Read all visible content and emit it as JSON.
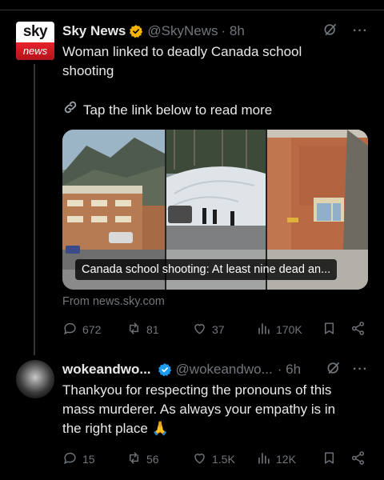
{
  "tweet1": {
    "avatar": {
      "top_text": "sky",
      "bottom_text": "news"
    },
    "name": "Sky News",
    "handle": "@SkyNews",
    "time": "· 8h",
    "text_line1": "Woman linked to deadly Canada school",
    "text_line2": "shooting",
    "link_text": "Tap the link below to read more",
    "card_caption": "Canada school shooting: At least nine dead an...",
    "card_source": "From news.sky.com",
    "replies": "672",
    "reposts": "81",
    "likes": "37",
    "views": "170K"
  },
  "tweet2": {
    "name": "wokeandwo...",
    "handle": "@wokeandwo...",
    "time": "· 6h",
    "text_line1": "Thankyou for respecting the pronouns of this",
    "text_line2": "mass murderer. As always your empathy is in",
    "text_line3": "the right place 🙏",
    "replies": "15",
    "reposts": "56",
    "likes": "1.5K",
    "views": "12K"
  },
  "colors": {
    "background": "#000000",
    "text": "#e7e9ea",
    "muted": "#71767b",
    "verified_badge_sky": "#f4b400",
    "verified_badge_user": "#1d9bf0"
  },
  "icons": [
    "grok-icon",
    "more-icon",
    "link-icon",
    "reply-icon",
    "repost-icon",
    "like-icon",
    "views-icon",
    "bookmark-icon",
    "share-icon"
  ]
}
